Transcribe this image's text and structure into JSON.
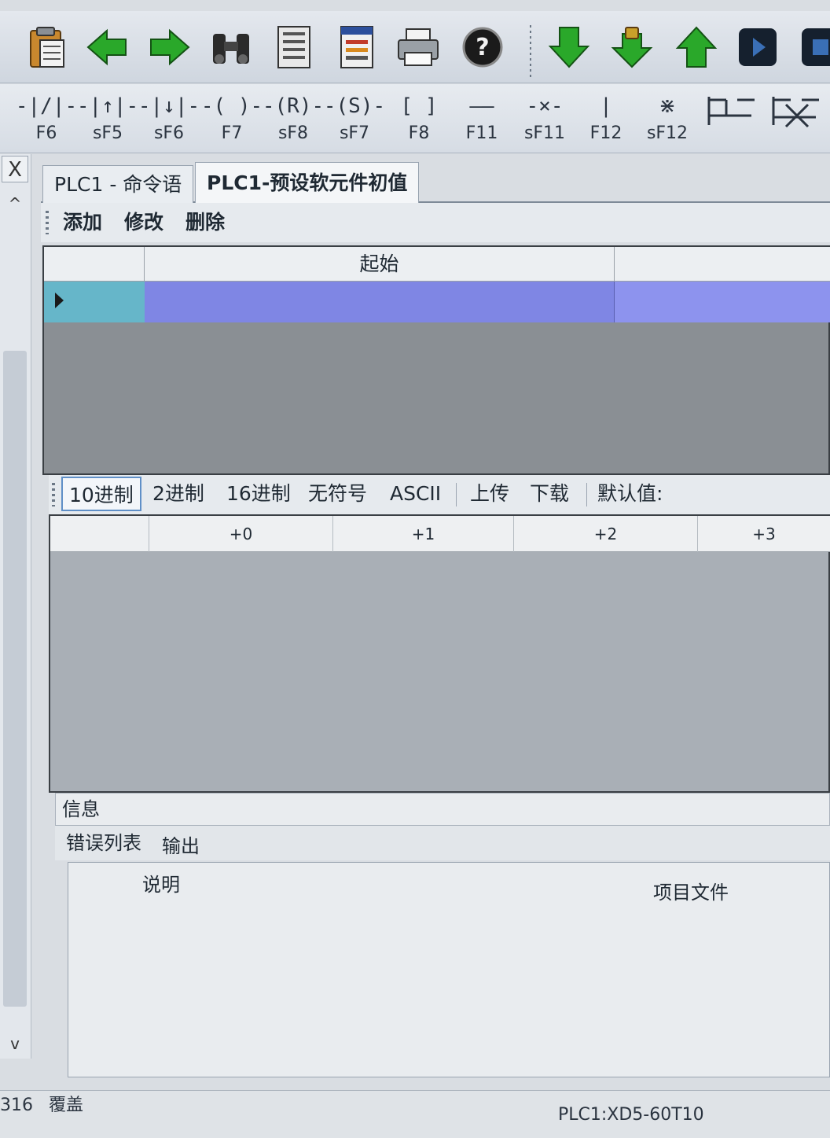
{
  "toolbar": {
    "icons": [
      "clipboard-icon",
      "arrow-left-icon",
      "arrow-right-icon",
      "binoculars-icon",
      "document-icon",
      "document-list-icon",
      "printer-icon",
      "help-icon",
      "download-icon",
      "download-locked-icon",
      "upload-icon",
      "run-icon",
      "stop-icon"
    ]
  },
  "ladder_toolbar": {
    "buttons": [
      {
        "symbol": "-|/|-",
        "key": "F6",
        "icon": "nc-contact-icon"
      },
      {
        "symbol": "-|↑|-",
        "key": "sF5",
        "icon": "rising-edge-contact-icon"
      },
      {
        "symbol": "-|↓|-",
        "key": "sF6",
        "icon": "falling-edge-contact-icon"
      },
      {
        "symbol": "-( )-",
        "key": "F7",
        "icon": "output-coil-icon"
      },
      {
        "symbol": "-(R)-",
        "key": "sF8",
        "icon": "reset-coil-icon"
      },
      {
        "symbol": "-(S)-",
        "key": "sF7",
        "icon": "set-coil-icon"
      },
      {
        "symbol": "[   ]",
        "key": "F8",
        "icon": "instruction-box-icon"
      },
      {
        "symbol": "——",
        "key": "F11",
        "icon": "horizontal-line-icon"
      },
      {
        "symbol": "-×-",
        "key": "sF11",
        "icon": "delete-horizontal-line-icon"
      },
      {
        "symbol": "|",
        "key": "F12",
        "icon": "vertical-line-icon"
      },
      {
        "symbol": "⋇",
        "key": "sF12",
        "icon": "delete-vertical-line-icon"
      },
      {
        "symbol": "",
        "key": "",
        "icon": "parallel-branch-icon"
      },
      {
        "symbol": "",
        "key": "",
        "icon": "delete-branch-icon"
      }
    ]
  },
  "left_dock": {
    "close_glyph": "X",
    "scroll_up_glyph": "^",
    "scroll_down_glyph": "v"
  },
  "doc_tabs": [
    {
      "label": "PLC1 - 命令语",
      "active": false
    },
    {
      "label": "PLC1-预设软元件初值",
      "active": true
    }
  ],
  "edit_bar": {
    "add": "添加",
    "modify": "修改",
    "delete": "删除"
  },
  "grid1": {
    "column_start": "起始"
  },
  "radix_bar": {
    "buttons": [
      {
        "label": "10进制",
        "selected": true
      },
      {
        "label": "2进制",
        "selected": false
      },
      {
        "label": "16进制",
        "selected": false
      },
      {
        "label": "无符号",
        "selected": false
      },
      {
        "label": "ASCII",
        "selected": false
      },
      {
        "label": "上传",
        "selected": false
      },
      {
        "label": "下载",
        "selected": false
      },
      {
        "label": "默认值:",
        "selected": false
      }
    ]
  },
  "grid2": {
    "columns": [
      "+0",
      "+1",
      "+2",
      "+3"
    ]
  },
  "info_panel": {
    "title": "信息",
    "tabs": [
      "错误列表",
      "输出"
    ],
    "columns": [
      "说明",
      "项目文件"
    ]
  },
  "status_bar": {
    "position": "316",
    "mode": "覆盖",
    "device": "PLC1:XD5-60T10"
  },
  "colors": {
    "selected_row": "#7f86e4",
    "row_header": "#66b6c9",
    "arrow_green": "#2aa82a"
  }
}
